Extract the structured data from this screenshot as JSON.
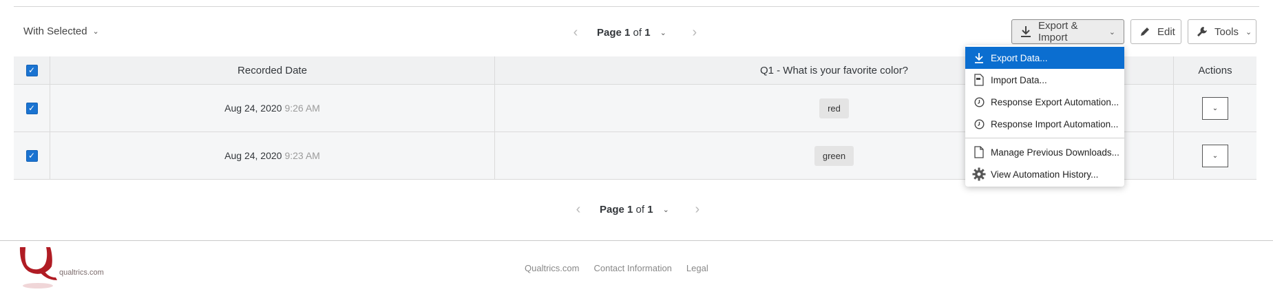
{
  "toolbar": {
    "with_selected": "With Selected",
    "export_import": "Export & Import",
    "edit": "Edit",
    "tools": "Tools"
  },
  "pager": {
    "page_word": "Page",
    "current": "1",
    "of_word": "of",
    "total": "1"
  },
  "table": {
    "headers": [
      "Recorded Date",
      "Q1 - What is your favorite color?",
      "Actions"
    ],
    "rows": [
      {
        "date": "Aug 24, 2020",
        "time": "9:26 AM",
        "answer": "red"
      },
      {
        "date": "Aug 24, 2020",
        "time": "9:23 AM",
        "answer": "green"
      }
    ]
  },
  "menu": {
    "items": [
      {
        "label": "Export Data...",
        "icon": "download-icon",
        "highlighted": true
      },
      {
        "label": "Import Data...",
        "icon": "file-import-icon"
      },
      {
        "label": "Response Export Automation...",
        "icon": "clock-icon"
      },
      {
        "label": "Response Import Automation...",
        "icon": "clock-icon"
      },
      {
        "label": "Manage Previous Downloads...",
        "icon": "document-icon"
      },
      {
        "label": "View Automation History...",
        "icon": "gear-icon"
      }
    ]
  },
  "footer": {
    "logo_text": "qualtrics.com",
    "links": [
      "Qualtrics.com",
      "Contact Information",
      "Legal"
    ]
  },
  "colors": {
    "accent": "#0b6ed0",
    "checkbox": "#1a73d1",
    "brand": "#b01c24"
  }
}
